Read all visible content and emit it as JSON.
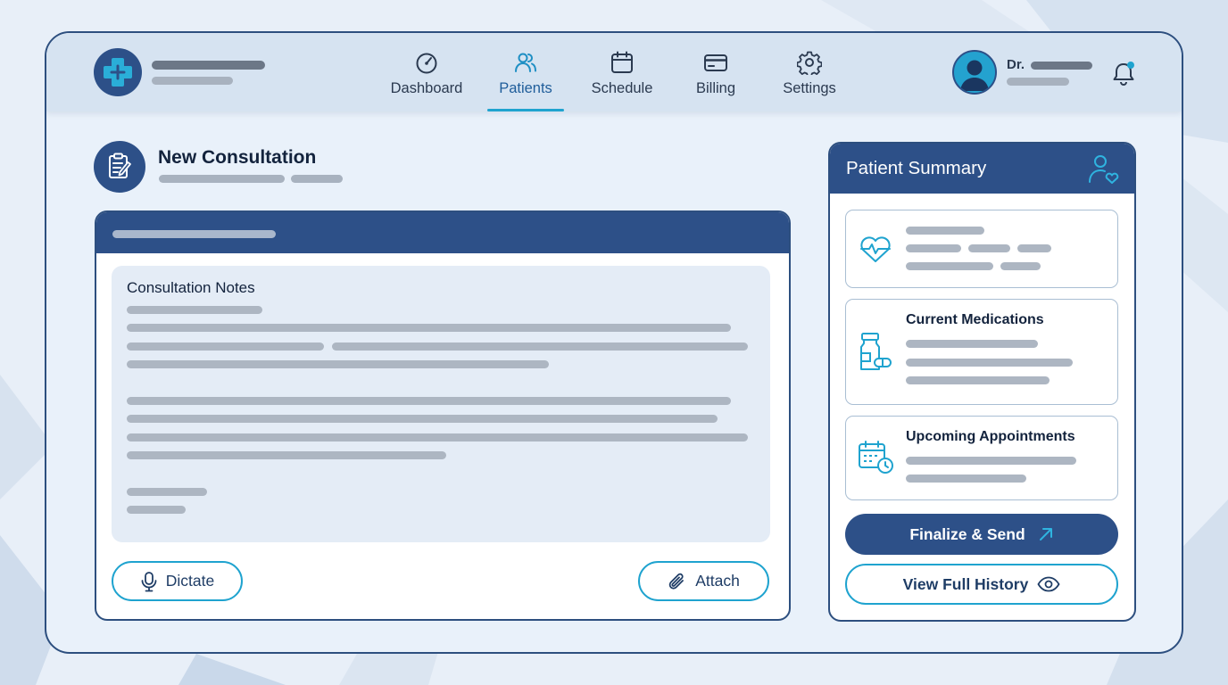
{
  "nav": {
    "items": [
      {
        "label": "Dashboard",
        "icon": "gauge-icon"
      },
      {
        "label": "Patients",
        "icon": "users-icon",
        "active": true
      },
      {
        "label": "Schedule",
        "icon": "calendar-icon"
      },
      {
        "label": "Billing",
        "icon": "credit-card-icon"
      },
      {
        "label": "Settings",
        "icon": "gear-icon"
      }
    ]
  },
  "user": {
    "prefix": "Dr."
  },
  "page": {
    "title": "New Consultation"
  },
  "editor": {
    "notes_title": "Consultation Notes",
    "dictate_label": "Dictate",
    "attach_label": "Attach"
  },
  "summary": {
    "title": "Patient Summary",
    "cards": [
      {
        "title": "",
        "icon": "heart-pulse-icon"
      },
      {
        "title": "Current Medications",
        "icon": "medication-icon"
      },
      {
        "title": "Upcoming Appointments",
        "icon": "calendar-clock-icon"
      }
    ],
    "finalize_label": "Finalize & Send",
    "history_label": "View Full History"
  },
  "colors": {
    "primary": "#2d5088",
    "accent": "#1fa3cf",
    "background": "#e8eff8",
    "placeholder": "#a8b2bf"
  }
}
